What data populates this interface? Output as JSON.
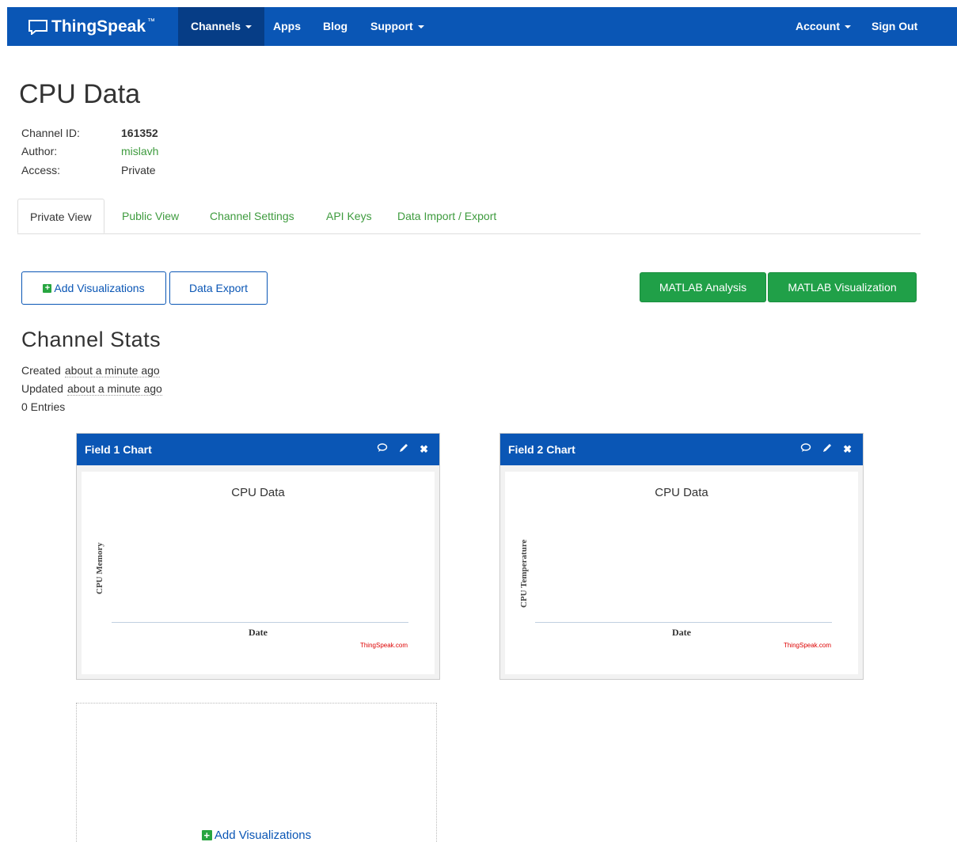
{
  "nav": {
    "brand": "ThingSpeak",
    "brand_tm": "™",
    "channels": "Channels",
    "apps": "Apps",
    "blog": "Blog",
    "support": "Support",
    "account": "Account",
    "sign_out": "Sign Out"
  },
  "channel": {
    "title": "CPU Data",
    "id_label": "Channel ID:",
    "id_value": "161352",
    "author_label": "Author:",
    "author_value": "mislavh",
    "access_label": "Access:",
    "access_value": "Private"
  },
  "tabs": [
    {
      "label": "Private View"
    },
    {
      "label": "Public View"
    },
    {
      "label": "Channel Settings"
    },
    {
      "label": "API Keys"
    },
    {
      "label": "Data Import / Export"
    }
  ],
  "buttons": {
    "add_visualizations": "Add Visualizations",
    "data_export": "Data Export",
    "matlab_analysis": "MATLAB Analysis",
    "matlab_visualization": "MATLAB Visualization"
  },
  "stats": {
    "title": "Channel Stats",
    "created_label": "Created",
    "created_value": "about a minute ago",
    "updated_label": "Updated",
    "updated_value": "about a minute ago",
    "entries": "0 Entries"
  },
  "charts": [
    {
      "panel_title": "Field 1 Chart",
      "title": "CPU Data",
      "ylabel": "CPU Memory",
      "xlabel": "Date",
      "credit": "ThingSpeak.com"
    },
    {
      "panel_title": "Field 2 Chart",
      "title": "CPU Data",
      "ylabel": "CPU Temperature",
      "xlabel": "Date",
      "credit": "ThingSpeak.com"
    }
  ],
  "empty_panel": {
    "add_label": "Add Visualizations"
  },
  "colors": {
    "brand_blue": "#0a56b5",
    "green_link": "#3e9b3e",
    "green_button": "#20a048"
  }
}
